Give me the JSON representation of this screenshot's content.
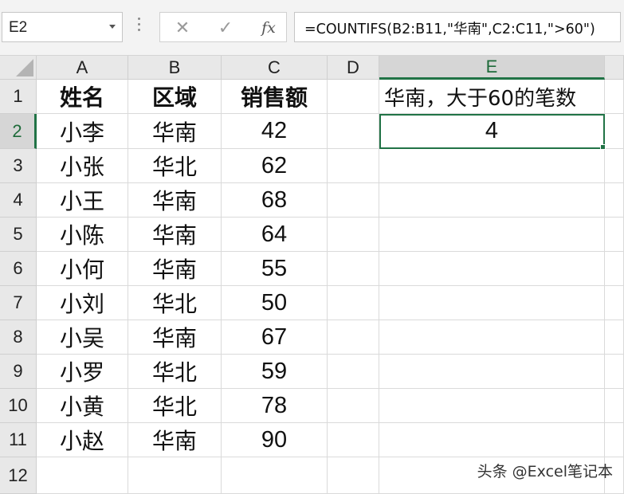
{
  "formula_bar": {
    "name_box": "E2",
    "fx_label": "fx",
    "formula": "=COUNTIFS(B2:B11,\"华南\",C2:C11,\">60\")"
  },
  "columns": [
    "A",
    "B",
    "C",
    "D",
    "E"
  ],
  "selected_column": "E",
  "rows": [
    "1",
    "2",
    "3",
    "4",
    "5",
    "6",
    "7",
    "8",
    "9",
    "10",
    "11",
    "12"
  ],
  "selected_row": "2",
  "headers": {
    "name": "姓名",
    "region": "区域",
    "sales": "销售额"
  },
  "records": [
    {
      "name": "小李",
      "region": "华南",
      "sales": "42"
    },
    {
      "name": "小张",
      "region": "华北",
      "sales": "62"
    },
    {
      "name": "小王",
      "region": "华南",
      "sales": "68"
    },
    {
      "name": "小陈",
      "region": "华南",
      "sales": "64"
    },
    {
      "name": "小何",
      "region": "华南",
      "sales": "55"
    },
    {
      "name": "小刘",
      "region": "华北",
      "sales": "50"
    },
    {
      "name": "小吴",
      "region": "华南",
      "sales": "67"
    },
    {
      "name": "小罗",
      "region": "华北",
      "sales": "59"
    },
    {
      "name": "小黄",
      "region": "华北",
      "sales": "78"
    },
    {
      "name": "小赵",
      "region": "华南",
      "sales": "90"
    }
  ],
  "result": {
    "label": "华南，大于60的笔数",
    "value": "4"
  },
  "watermark": "头条 @Excel笔记本",
  "colors": {
    "accent": "#217346",
    "header_bg": "#e8e8e8",
    "selected_header_bg": "#d6d6d6"
  }
}
